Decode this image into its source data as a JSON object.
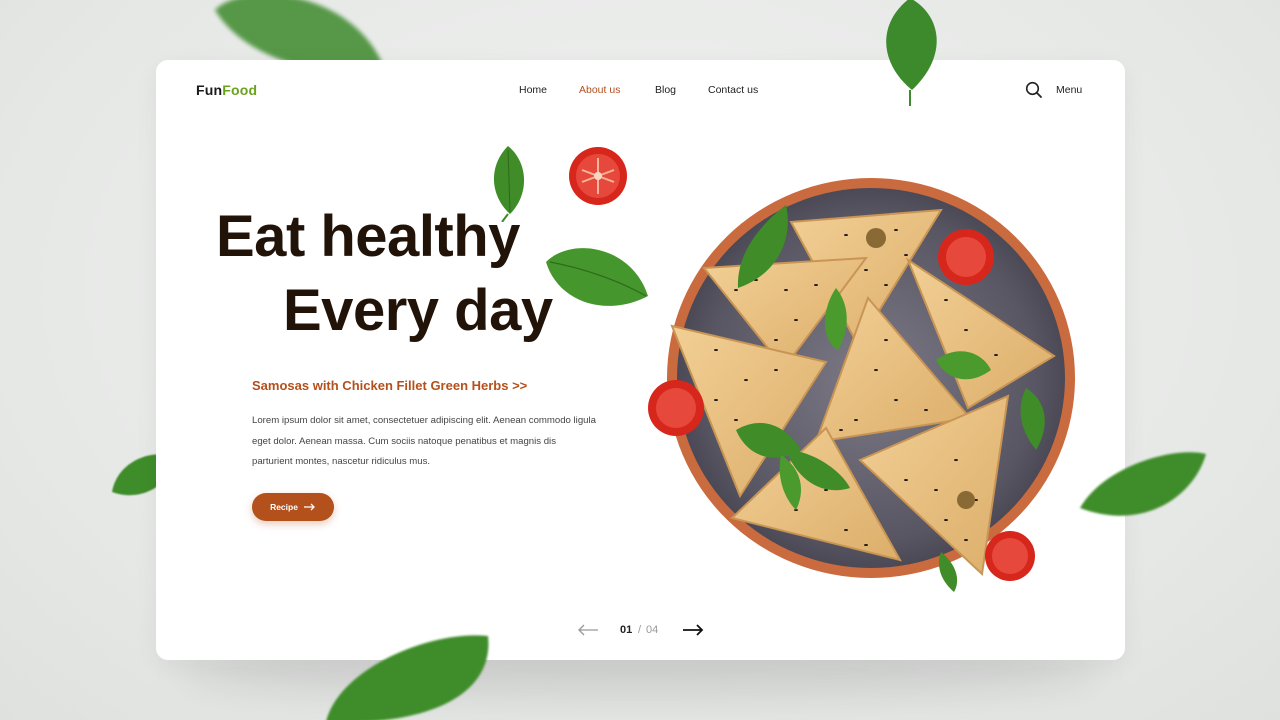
{
  "brand": {
    "part1": "Fun",
    "part2": "Food"
  },
  "nav": {
    "items": [
      {
        "label": "Home",
        "active": false
      },
      {
        "label": "About us",
        "active": true
      },
      {
        "label": "Blog",
        "active": false
      },
      {
        "label": "Contact us",
        "active": false
      }
    ],
    "search_icon": "search-icon",
    "menu_label": "Menu"
  },
  "hero": {
    "title_line1": "Eat healthy",
    "title_line2": "Every day",
    "subtitle": "Samosas with Chicken Fillet Green Herbs  >>",
    "description": "Lorem ipsum dolor sit amet, consectetuer adipiscing elit. Aenean commodo ligula eget dolor. Aenean massa. Cum sociis natoque penatibus et magnis dis parturient montes, nascetur ridiculus mus.",
    "button_label": "Recipe"
  },
  "pagination": {
    "current": "01",
    "separator": "/",
    "total": "04"
  },
  "colors": {
    "accent": "#b4501c",
    "brand_green": "#6aa21c",
    "title": "#221308",
    "background": "#e8eae8"
  }
}
